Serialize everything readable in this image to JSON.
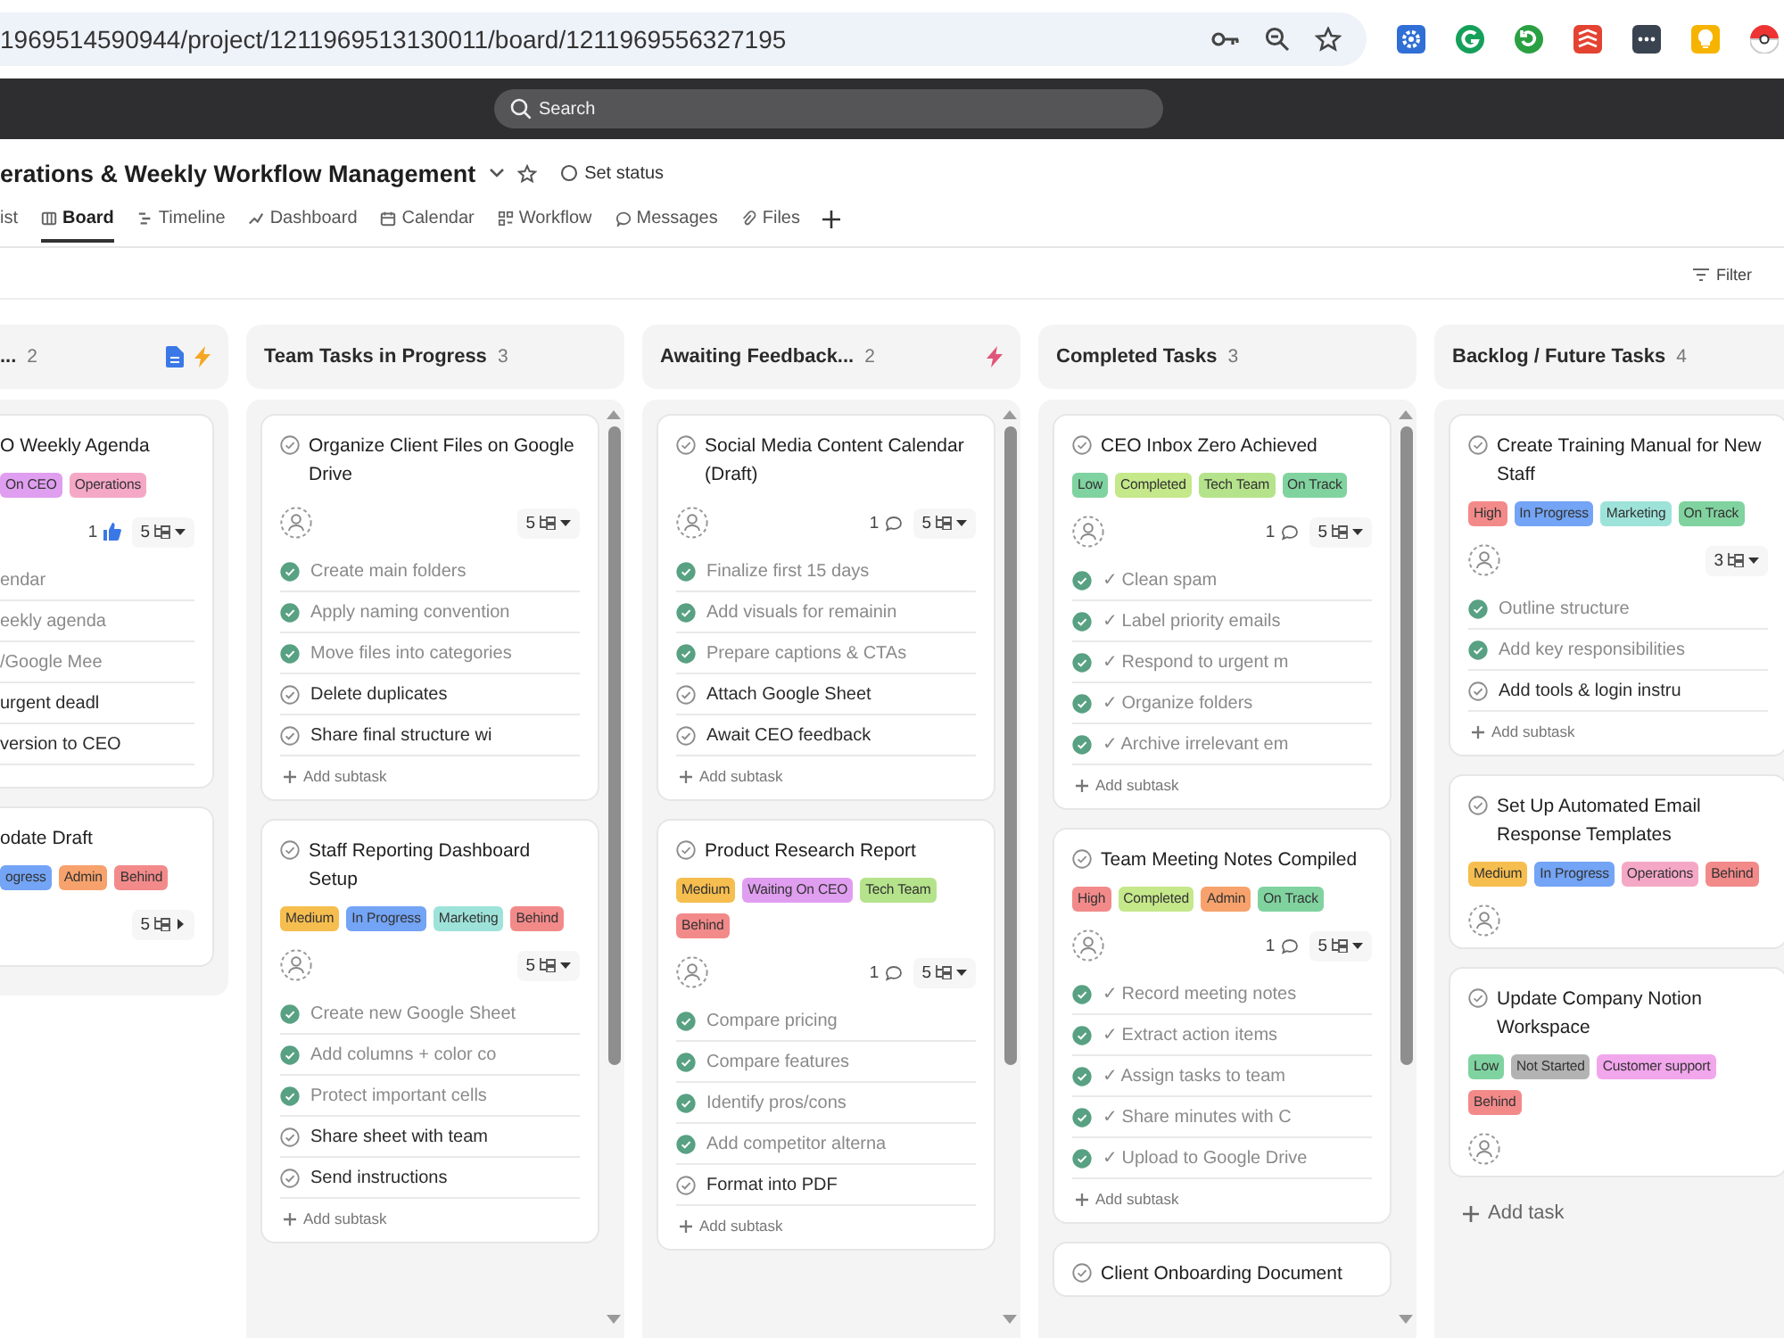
{
  "browser": {
    "url": "1969514590944/project/1211969513130011/board/1211969556327195"
  },
  "search": {
    "placeholder": "Search"
  },
  "project": {
    "title": "erations & Weekly Workflow Management",
    "status_label": "Set status"
  },
  "tabs": [
    {
      "label": "ist",
      "selected": false
    },
    {
      "label": "Board",
      "selected": true
    },
    {
      "label": "Timeline",
      "selected": false
    },
    {
      "label": "Dashboard",
      "selected": false
    },
    {
      "label": "Calendar",
      "selected": false
    },
    {
      "label": "Workflow",
      "selected": false
    },
    {
      "label": "Messages",
      "selected": false
    },
    {
      "label": "Files",
      "selected": false
    }
  ],
  "filter": {
    "label": "Filter"
  },
  "columns": [
    {
      "title": "...",
      "count": "2",
      "header_icons": [
        {
          "kind": "form"
        },
        {
          "kind": "rule"
        }
      ],
      "scrollbar": false,
      "cards": [
        {
          "title": "O Weekly Agenda",
          "tags": [
            {
              "label": "On CEO",
              "color": "#e09ef0"
            },
            {
              "label": "Operations",
              "color": "#f5a8c6"
            }
          ],
          "likes": "1",
          "subtask_count": "5",
          "subtasks_expanded": true,
          "subtasks": [
            {
              "label": "endar",
              "done": true
            },
            {
              "label": "eekly agenda",
              "done": true
            },
            {
              "label": "/Google Mee",
              "done": true
            },
            {
              "label": "urgent deadl",
              "done": false
            },
            {
              "label": "version to CEO",
              "done": false
            }
          ]
        },
        {
          "title": "odate Draft",
          "tags": [
            {
              "label": "ogress",
              "color": "#73a4f5"
            },
            {
              "label": "Admin",
              "color": "#f7a26c"
            },
            {
              "label": "Behind",
              "color": "#f38a8a"
            }
          ],
          "subtask_count": "5",
          "subtasks_expanded": false
        }
      ]
    },
    {
      "title": "Team Tasks in Progress",
      "count": "3",
      "scrollbar": true,
      "cards": [
        {
          "title": "Organize Client Files on Google Drive",
          "done": false,
          "avatar": true,
          "subtask_count": "5",
          "subtasks_expanded": true,
          "subtasks": [
            {
              "label": "Create main folders",
              "done": true
            },
            {
              "label": "Apply naming convention",
              "done": true
            },
            {
              "label": "Move files into categories",
              "done": true
            },
            {
              "label": "Delete duplicates",
              "done": false
            },
            {
              "label": "Share final structure wi",
              "done": false
            }
          ],
          "add_subtask": "Add subtask"
        },
        {
          "title": "Staff Reporting Dashboard Setup",
          "done": false,
          "tags": [
            {
              "label": "Medium",
              "color": "#f6be4f"
            },
            {
              "label": "In Progress",
              "color": "#73a4f5"
            },
            {
              "label": "Marketing",
              "color": "#9ee3da"
            },
            {
              "label": "Behind",
              "color": "#f38a8a"
            }
          ],
          "avatar": true,
          "subtask_count": "5",
          "subtasks_expanded": true,
          "subtasks": [
            {
              "label": "Create new Google Sheet",
              "done": true
            },
            {
              "label": "Add columns + color co",
              "done": true
            },
            {
              "label": "Protect important cells",
              "done": true
            },
            {
              "label": "Share sheet with team",
              "done": false
            },
            {
              "label": "Send instructions",
              "done": false
            }
          ],
          "add_subtask": "Add subtask"
        }
      ]
    },
    {
      "title": "Awaiting Feedback...",
      "count": "2",
      "header_icons": [
        {
          "kind": "rule"
        }
      ],
      "scrollbar": true,
      "cards": [
        {
          "title": "Social Media Content Calendar (Draft)",
          "done": false,
          "avatar": true,
          "comments": "1",
          "subtask_count": "5",
          "subtasks_expanded": true,
          "subtasks": [
            {
              "label": "Finalize first 15 days",
              "done": true
            },
            {
              "label": "Add visuals for remainin",
              "done": true
            },
            {
              "label": "Prepare captions & CTAs",
              "done": true
            },
            {
              "label": "Attach Google Sheet",
              "done": false
            },
            {
              "label": "Await CEO feedback",
              "done": false
            }
          ],
          "add_subtask": "Add subtask"
        },
        {
          "title": "Product Research Report",
          "done": false,
          "tags": [
            {
              "label": "Medium",
              "color": "#f6be4f"
            },
            {
              "label": "Waiting On CEO",
              "color": "#e09ef0"
            },
            {
              "label": "Tech Team",
              "color": "#b5e38b"
            },
            {
              "label": "Behind",
              "color": "#f38a8a"
            }
          ],
          "avatar": true,
          "comments": "1",
          "subtask_count": "5",
          "subtasks_expanded": true,
          "subtasks": [
            {
              "label": "Compare pricing",
              "done": true
            },
            {
              "label": "Compare features",
              "done": true
            },
            {
              "label": "Identify pros/cons",
              "done": true
            },
            {
              "label": "Add competitor alterna",
              "done": true
            },
            {
              "label": "Format into PDF",
              "done": false
            }
          ],
          "add_subtask": "Add subtask"
        }
      ]
    },
    {
      "title": "Completed Tasks",
      "count": "3",
      "scrollbar": true,
      "cards": [
        {
          "title": "CEO Inbox Zero Achieved",
          "done": false,
          "tags": [
            {
              "label": "Low",
              "color": "#7fd3a0"
            },
            {
              "label": "Completed",
              "color": "#c5e88a"
            },
            {
              "label": "Tech Team",
              "color": "#b5e38b"
            },
            {
              "label": "On Track",
              "color": "#80d39f"
            }
          ],
          "avatar": true,
          "comments": "1",
          "subtask_count": "5",
          "subtasks_expanded": true,
          "subtasks": [
            {
              "label": "✓ Clean spam",
              "done": true
            },
            {
              "label": "✓ Label priority emails",
              "done": true
            },
            {
              "label": "✓ Respond to urgent m",
              "done": true
            },
            {
              "label": "✓ Organize folders",
              "done": true
            },
            {
              "label": "✓ Archive irrelevant em",
              "done": true
            }
          ],
          "add_subtask": "Add subtask"
        },
        {
          "title": "Team Meeting Notes Compiled",
          "done": false,
          "tags": [
            {
              "label": "High",
              "color": "#f38a8a"
            },
            {
              "label": "Completed",
              "color": "#c5e88a"
            },
            {
              "label": "Admin",
              "color": "#f7a26c"
            },
            {
              "label": "On Track",
              "color": "#80d39f"
            }
          ],
          "avatar": true,
          "comments": "1",
          "subtask_count": "5",
          "subtasks_expanded": true,
          "subtasks": [
            {
              "label": "✓ Record meeting notes",
              "done": true
            },
            {
              "label": "✓ Extract action items",
              "done": true
            },
            {
              "label": "✓ Assign tasks to team",
              "done": true
            },
            {
              "label": "✓ Share minutes with C",
              "done": true
            },
            {
              "label": "✓ Upload to Google Drive",
              "done": true
            }
          ],
          "add_subtask": "Add subtask"
        },
        {
          "title": "Client Onboarding Document",
          "done": false
        }
      ]
    },
    {
      "title": "Backlog / Future Tasks",
      "count": "4",
      "scrollbar": false,
      "add_task": "Add task",
      "cards": [
        {
          "title": "Create Training Manual for New Staff",
          "done": false,
          "tags": [
            {
              "label": "High",
              "color": "#f38a8a"
            },
            {
              "label": "In Progress",
              "color": "#73a4f5"
            },
            {
              "label": "Marketing",
              "color": "#9ee3da"
            },
            {
              "label": "On Track",
              "color": "#80d39f"
            }
          ],
          "avatar": true,
          "subtask_count": "3",
          "subtasks_expanded": true,
          "subtasks": [
            {
              "label": "Outline structure",
              "done": true
            },
            {
              "label": "Add key responsibilities",
              "done": true
            },
            {
              "label": "Add tools & login instru",
              "done": false
            }
          ],
          "add_subtask": "Add subtask"
        },
        {
          "title": "Set Up Automated Email Response Templates",
          "done": false,
          "tags": [
            {
              "label": "Medium",
              "color": "#f6be4f"
            },
            {
              "label": "In Progress",
              "color": "#73a4f5"
            },
            {
              "label": "Operations",
              "color": "#f5a8c6"
            },
            {
              "label": "Behind",
              "color": "#f38a8a"
            }
          ],
          "avatar": true
        },
        {
          "title": "Update Company Notion Workspace",
          "done": false,
          "tags": [
            {
              "label": "Low",
              "color": "#7fd3a0"
            },
            {
              "label": "Not Started",
              "color": "#b3b3b3"
            },
            {
              "label": "Customer support",
              "color": "#f2a6ec"
            },
            {
              "label": "Behind",
              "color": "#f38a8a"
            }
          ],
          "avatar": true
        }
      ]
    }
  ]
}
